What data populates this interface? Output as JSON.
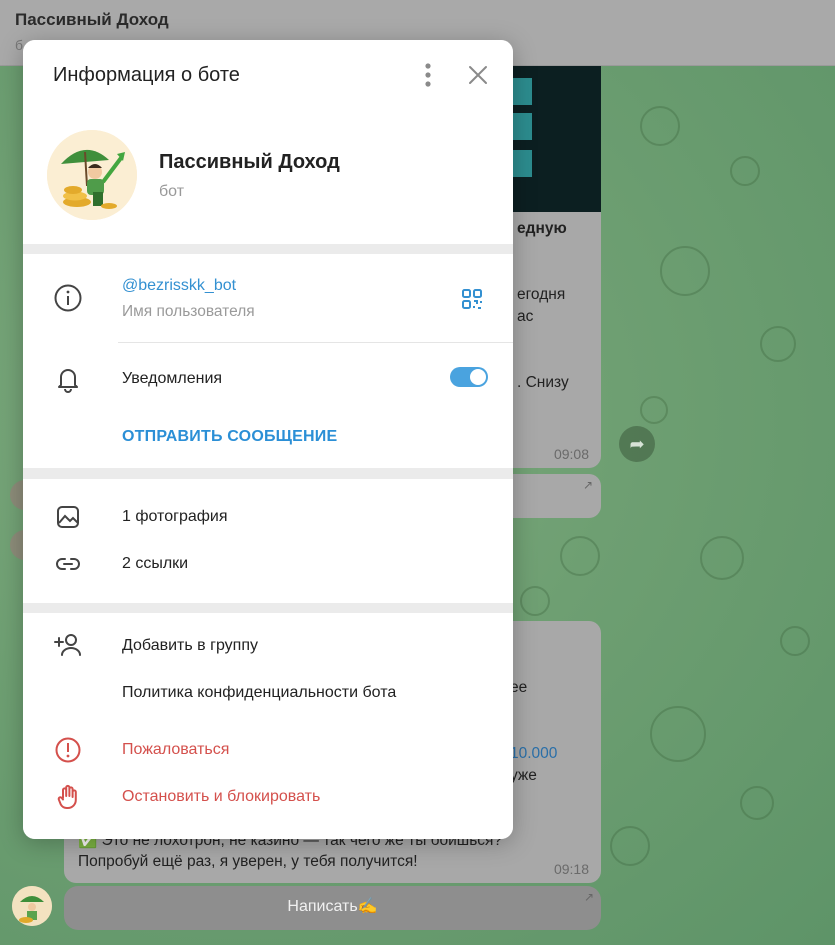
{
  "background": {
    "chat_title": "Пассивный Доход",
    "chat_subtitle": "б",
    "bubble1_text_a": "едную",
    "bubble1_text_b": "егодня",
    "bubble1_text_c": "ас",
    "bubble1_text_d": ". Снизу",
    "bubble1_time": "09:08",
    "bubble2_text_a": "ее",
    "bubble2_text_b": "10.000",
    "bubble2_text_c": "уже",
    "bubble2_text_d": "✅ Это не лохотрон, не казино — так чего же ты боишься?",
    "bubble2_text_e": "Попробуй ещё раз, я уверен, у тебя получится!",
    "bubble2_time": "09:18",
    "compose_label": "Написать✍️"
  },
  "modal": {
    "title": "Информация о боте",
    "profile": {
      "name": "Пассивный Доход",
      "subtitle": "бот"
    },
    "info": {
      "username": "@bezrisskk_bot",
      "username_caption": "Имя пользователя",
      "notifications_label": "Уведомления",
      "notifications_on": true,
      "send_message": "ОТПРАВИТЬ СООБЩЕНИЕ"
    },
    "media": {
      "photos": "1 фотография",
      "links": "2 ссылки"
    },
    "actions": {
      "add_to_group": "Добавить в группу",
      "privacy_policy": "Политика конфиденциальности бота",
      "report": "Пожаловаться",
      "stop_block": "Остановить и блокировать"
    }
  },
  "colors": {
    "accent": "#3390d1",
    "danger": "#d4504c",
    "toggle_on": "#4aa3df"
  }
}
